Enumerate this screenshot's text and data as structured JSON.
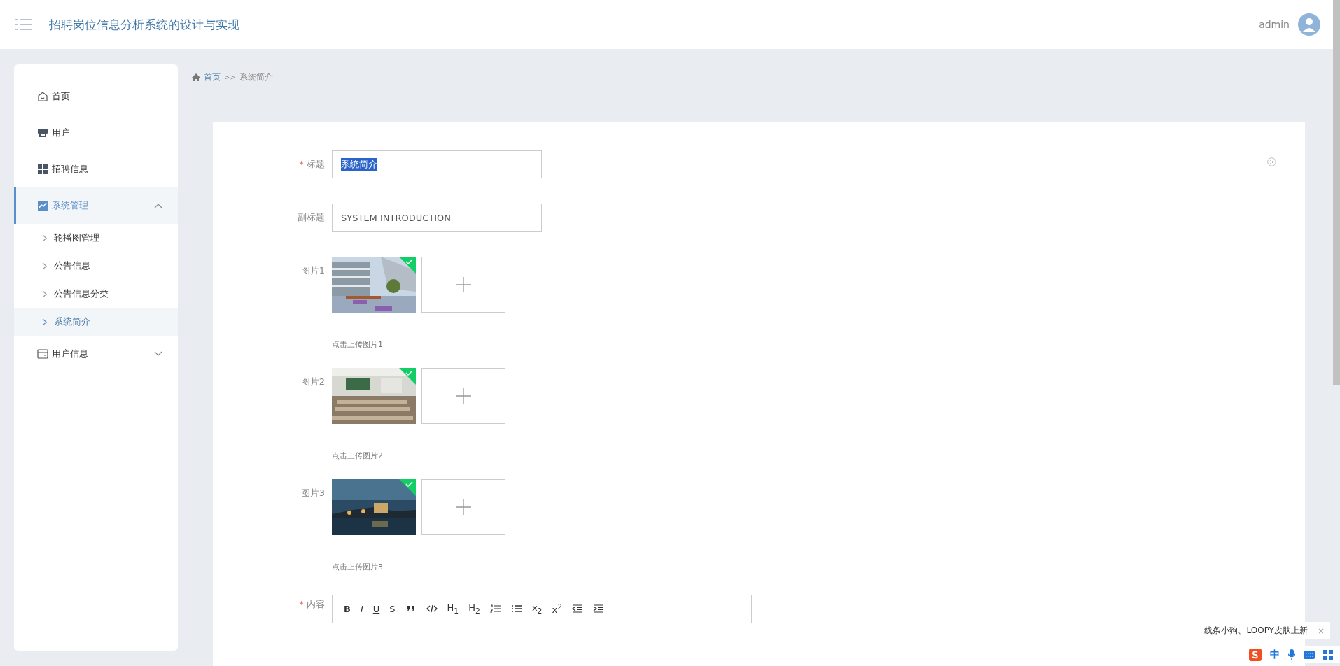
{
  "header": {
    "title": "招聘岗位信息分析系统的设计与实现",
    "user": "admin"
  },
  "sidebar": {
    "items": [
      {
        "label": "首页",
        "selected": false
      },
      {
        "label": "用户",
        "selected": false
      },
      {
        "label": "招聘信息",
        "selected": false
      },
      {
        "label": "系统管理",
        "selected": true,
        "expanded": true,
        "children": [
          {
            "label": "轮播图管理",
            "selected": false
          },
          {
            "label": "公告信息",
            "selected": false
          },
          {
            "label": "公告信息分类",
            "selected": false
          },
          {
            "label": "系统简介",
            "selected": true
          }
        ]
      },
      {
        "label": "用户信息",
        "selected": false,
        "expanded": false
      }
    ]
  },
  "breadcrumb": {
    "home": "首页",
    "separator": ">>",
    "current": "系统简介"
  },
  "form": {
    "fields": [
      {
        "kind": "text",
        "label": "标题",
        "required_mark": "*",
        "value": "系统简介",
        "text_selected": true
      },
      {
        "kind": "text",
        "label": "副标题",
        "value": "SYSTEM INTRODUCTION",
        "text_selected": false
      },
      {
        "label": "图片1",
        "uploaded": true,
        "hint": "点击上传图片1"
      },
      {
        "label": "图片2",
        "uploaded": true,
        "hint": "点击上传图片2"
      },
      {
        "label": "图片3",
        "uploaded": true,
        "hint": "点击上传图片3"
      },
      {
        "kind": "editor",
        "label": "内容",
        "required_mark": "*",
        "toolbar": [
          {
            "kind": "bold",
            "label": "B"
          },
          {
            "kind": "italic",
            "label": "I"
          },
          {
            "kind": "underline",
            "label": "U"
          },
          {
            "kind": "strike",
            "label": "S"
          },
          {
            "kind": "quote"
          },
          {
            "kind": "code"
          },
          {
            "kind": "plain",
            "label": "H$_{1}$"
          },
          {
            "kind": "plain",
            "label": "H$_{2}$"
          },
          {
            "kind": "ordered-list"
          },
          {
            "kind": "bullet-list"
          },
          {
            "kind": "plain",
            "label": "x$_{2}$"
          },
          {
            "kind": "plain",
            "label": "x$^{2}$"
          },
          {
            "kind": "outdent"
          },
          {
            "kind": "indent"
          }
        ]
      }
    ]
  },
  "notification": {
    "text": "线条小狗、LOOPY皮肤上新",
    "close": "×"
  },
  "ime_bar": {
    "mode": "中"
  }
}
